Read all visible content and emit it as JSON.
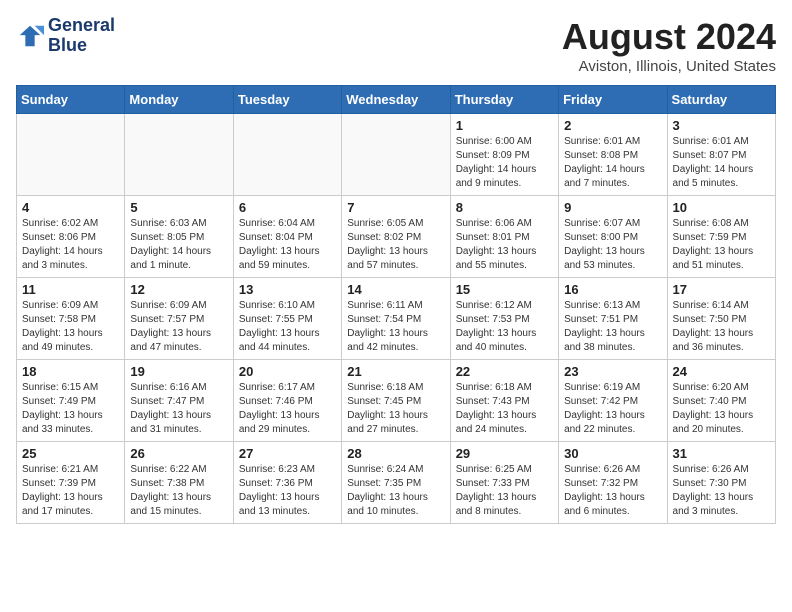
{
  "header": {
    "logo_line1": "General",
    "logo_line2": "Blue",
    "main_title": "August 2024",
    "subtitle": "Aviston, Illinois, United States"
  },
  "calendar": {
    "days_of_week": [
      "Sunday",
      "Monday",
      "Tuesday",
      "Wednesday",
      "Thursday",
      "Friday",
      "Saturday"
    ],
    "weeks": [
      [
        {
          "day": "",
          "info": ""
        },
        {
          "day": "",
          "info": ""
        },
        {
          "day": "",
          "info": ""
        },
        {
          "day": "",
          "info": ""
        },
        {
          "day": "1",
          "info": "Sunrise: 6:00 AM\nSunset: 8:09 PM\nDaylight: 14 hours\nand 9 minutes."
        },
        {
          "day": "2",
          "info": "Sunrise: 6:01 AM\nSunset: 8:08 PM\nDaylight: 14 hours\nand 7 minutes."
        },
        {
          "day": "3",
          "info": "Sunrise: 6:01 AM\nSunset: 8:07 PM\nDaylight: 14 hours\nand 5 minutes."
        }
      ],
      [
        {
          "day": "4",
          "info": "Sunrise: 6:02 AM\nSunset: 8:06 PM\nDaylight: 14 hours\nand 3 minutes."
        },
        {
          "day": "5",
          "info": "Sunrise: 6:03 AM\nSunset: 8:05 PM\nDaylight: 14 hours\nand 1 minute."
        },
        {
          "day": "6",
          "info": "Sunrise: 6:04 AM\nSunset: 8:04 PM\nDaylight: 13 hours\nand 59 minutes."
        },
        {
          "day": "7",
          "info": "Sunrise: 6:05 AM\nSunset: 8:02 PM\nDaylight: 13 hours\nand 57 minutes."
        },
        {
          "day": "8",
          "info": "Sunrise: 6:06 AM\nSunset: 8:01 PM\nDaylight: 13 hours\nand 55 minutes."
        },
        {
          "day": "9",
          "info": "Sunrise: 6:07 AM\nSunset: 8:00 PM\nDaylight: 13 hours\nand 53 minutes."
        },
        {
          "day": "10",
          "info": "Sunrise: 6:08 AM\nSunset: 7:59 PM\nDaylight: 13 hours\nand 51 minutes."
        }
      ],
      [
        {
          "day": "11",
          "info": "Sunrise: 6:09 AM\nSunset: 7:58 PM\nDaylight: 13 hours\nand 49 minutes."
        },
        {
          "day": "12",
          "info": "Sunrise: 6:09 AM\nSunset: 7:57 PM\nDaylight: 13 hours\nand 47 minutes."
        },
        {
          "day": "13",
          "info": "Sunrise: 6:10 AM\nSunset: 7:55 PM\nDaylight: 13 hours\nand 44 minutes."
        },
        {
          "day": "14",
          "info": "Sunrise: 6:11 AM\nSunset: 7:54 PM\nDaylight: 13 hours\nand 42 minutes."
        },
        {
          "day": "15",
          "info": "Sunrise: 6:12 AM\nSunset: 7:53 PM\nDaylight: 13 hours\nand 40 minutes."
        },
        {
          "day": "16",
          "info": "Sunrise: 6:13 AM\nSunset: 7:51 PM\nDaylight: 13 hours\nand 38 minutes."
        },
        {
          "day": "17",
          "info": "Sunrise: 6:14 AM\nSunset: 7:50 PM\nDaylight: 13 hours\nand 36 minutes."
        }
      ],
      [
        {
          "day": "18",
          "info": "Sunrise: 6:15 AM\nSunset: 7:49 PM\nDaylight: 13 hours\nand 33 minutes."
        },
        {
          "day": "19",
          "info": "Sunrise: 6:16 AM\nSunset: 7:47 PM\nDaylight: 13 hours\nand 31 minutes."
        },
        {
          "day": "20",
          "info": "Sunrise: 6:17 AM\nSunset: 7:46 PM\nDaylight: 13 hours\nand 29 minutes."
        },
        {
          "day": "21",
          "info": "Sunrise: 6:18 AM\nSunset: 7:45 PM\nDaylight: 13 hours\nand 27 minutes."
        },
        {
          "day": "22",
          "info": "Sunrise: 6:18 AM\nSunset: 7:43 PM\nDaylight: 13 hours\nand 24 minutes."
        },
        {
          "day": "23",
          "info": "Sunrise: 6:19 AM\nSunset: 7:42 PM\nDaylight: 13 hours\nand 22 minutes."
        },
        {
          "day": "24",
          "info": "Sunrise: 6:20 AM\nSunset: 7:40 PM\nDaylight: 13 hours\nand 20 minutes."
        }
      ],
      [
        {
          "day": "25",
          "info": "Sunrise: 6:21 AM\nSunset: 7:39 PM\nDaylight: 13 hours\nand 17 minutes."
        },
        {
          "day": "26",
          "info": "Sunrise: 6:22 AM\nSunset: 7:38 PM\nDaylight: 13 hours\nand 15 minutes."
        },
        {
          "day": "27",
          "info": "Sunrise: 6:23 AM\nSunset: 7:36 PM\nDaylight: 13 hours\nand 13 minutes."
        },
        {
          "day": "28",
          "info": "Sunrise: 6:24 AM\nSunset: 7:35 PM\nDaylight: 13 hours\nand 10 minutes."
        },
        {
          "day": "29",
          "info": "Sunrise: 6:25 AM\nSunset: 7:33 PM\nDaylight: 13 hours\nand 8 minutes."
        },
        {
          "day": "30",
          "info": "Sunrise: 6:26 AM\nSunset: 7:32 PM\nDaylight: 13 hours\nand 6 minutes."
        },
        {
          "day": "31",
          "info": "Sunrise: 6:26 AM\nSunset: 7:30 PM\nDaylight: 13 hours\nand 3 minutes."
        }
      ]
    ]
  }
}
